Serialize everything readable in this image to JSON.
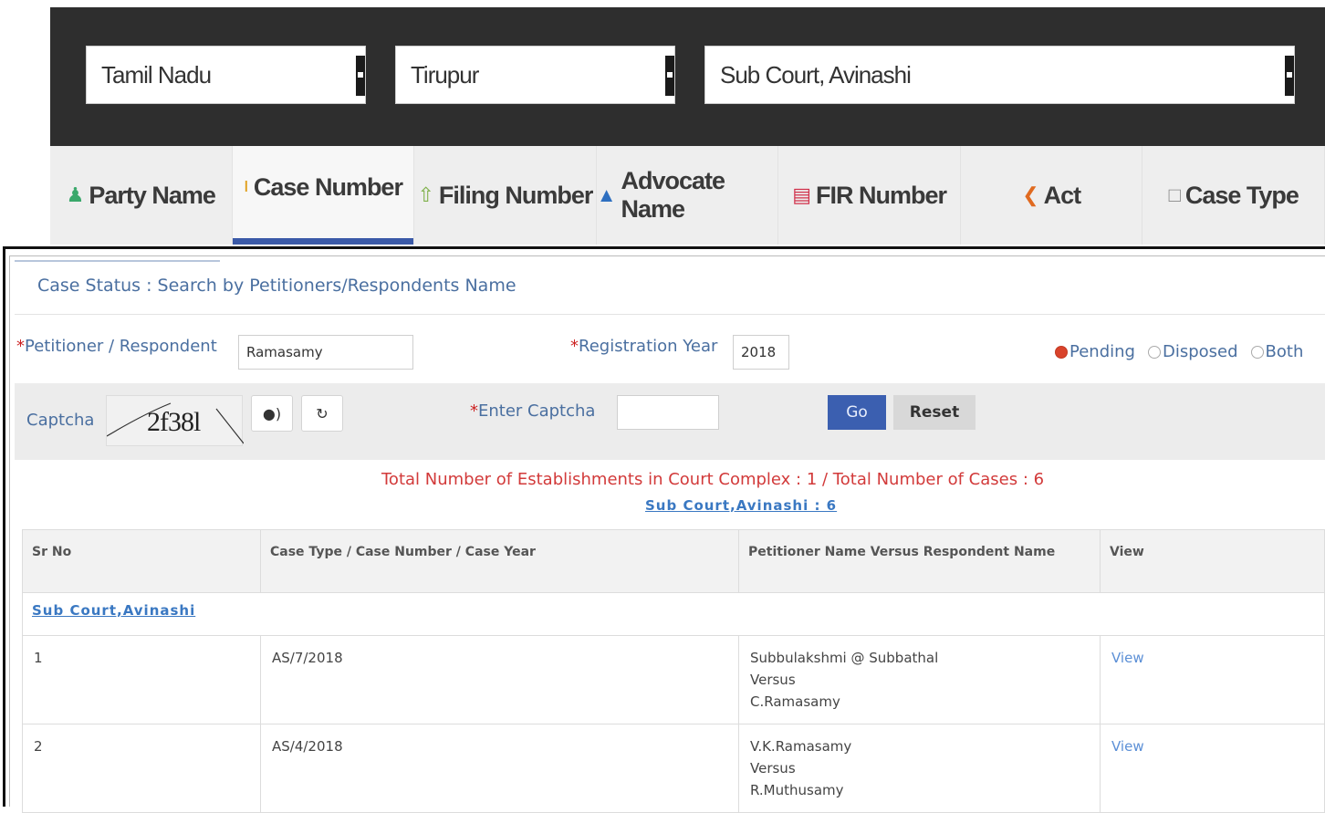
{
  "header": {
    "state": "Tamil Nadu",
    "district": "Tirupur",
    "court": "Sub Court, Avinashi"
  },
  "tabs": [
    {
      "label": "Party Name",
      "icon": "person-icon",
      "color": "#3aa86b"
    },
    {
      "label": "Case Number",
      "icon": "info-icon",
      "color": "#e0a020"
    },
    {
      "label": "Filing Number",
      "icon": "document-up-icon",
      "color": "#7fb04a"
    },
    {
      "label": "Advocate Name",
      "icon": "user-icon",
      "color": "#2e6fc0"
    },
    {
      "label": "FIR Number",
      "icon": "report-icon",
      "color": "#d0304a"
    },
    {
      "label": "Act",
      "icon": "gavel-icon",
      "color": "#e06a20"
    },
    {
      "label": "Case Type",
      "icon": "file-icon",
      "color": "#888888"
    }
  ],
  "form": {
    "title": "Case Status : Search by Petitioners/Respondents Name",
    "party_label": "*Petitioner / Respondent",
    "party_value": "Ramasamy",
    "year_label": "*Registration Year",
    "year_value": "2018",
    "status_options": [
      "Pending",
      "Disposed",
      "Both"
    ],
    "status_selected": "Pending",
    "captcha_label": "Captcha",
    "captcha_text": "2f38l",
    "enter_captcha_label": "*Enter Captcha",
    "go_label": "Go",
    "reset_label": "Reset"
  },
  "summary": {
    "line": "Total Number of Establishments in Court Complex :  1  /  Total Number of Cases : 6",
    "establishment_link": "Sub Court,Avinashi : 6"
  },
  "table": {
    "headers": [
      "Sr No",
      "Case Type / Case Number / Case Year",
      "Petitioner Name Versus Respondent Name",
      "View"
    ],
    "court_group": "Sub Court,Avinashi",
    "rows": [
      {
        "sr": "1",
        "case": "AS/7/2018",
        "petitioner": "Subbulakshmi @ Subbathal",
        "versus": "Versus",
        "respondent": "C.Ramasamy",
        "view": "View"
      },
      {
        "sr": "2",
        "case": "AS/4/2018",
        "petitioner": "V.K.Ramasamy",
        "versus": "Versus",
        "respondent": "R.Muthusamy",
        "view": "View"
      }
    ]
  },
  "colors": {
    "header_bg": "#2e2e2e",
    "tab_active_underline": "#3b5aa8",
    "label_blue": "#4a6fa0",
    "required_red": "#cc2222",
    "go_button": "#3b5fb0",
    "summary_red": "#d23a3a",
    "link_blue": "#3a78c2"
  }
}
